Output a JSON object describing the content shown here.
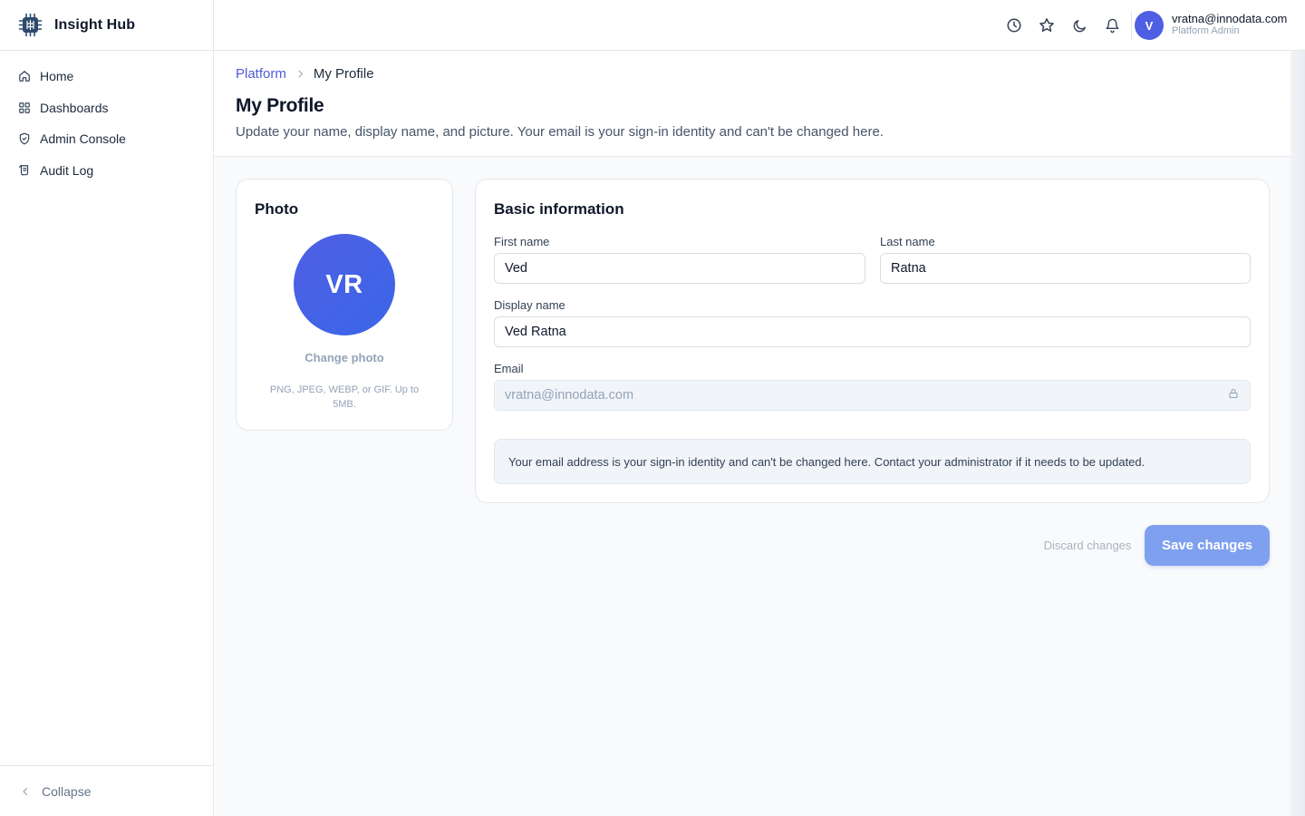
{
  "app": {
    "name": "Insight Hub"
  },
  "sidebar": {
    "items": [
      {
        "label": "Home",
        "icon": "home-icon"
      },
      {
        "label": "Dashboards",
        "icon": "grid-icon"
      },
      {
        "label": "Admin Console",
        "icon": "shield-check-icon"
      },
      {
        "label": "Audit Log",
        "icon": "scroll-icon"
      }
    ],
    "collapse_label": "Collapse"
  },
  "topbar": {
    "icons": [
      "history-icon",
      "star-icon",
      "moon-icon",
      "bell-icon"
    ],
    "user": {
      "initial": "V",
      "email": "vratna@innodata.com",
      "role": "Platform Admin"
    }
  },
  "breadcrumb": {
    "parent": "Platform",
    "current": "My Profile"
  },
  "page": {
    "title": "My Profile",
    "subtitle": "Update your name, display name, and picture. Your email is your sign-in identity and can't be changed here."
  },
  "photo_card": {
    "title": "Photo",
    "initials": "VR",
    "change_label": "Change photo",
    "hint": "PNG, JPEG, WEBP, or GIF. Up to 5MB."
  },
  "basic_info": {
    "title": "Basic information",
    "first_name": {
      "label": "First name",
      "value": "Ved"
    },
    "last_name": {
      "label": "Last name",
      "value": "Ratna"
    },
    "display_name": {
      "label": "Display name",
      "value": "Ved Ratna"
    },
    "email": {
      "label": "Email",
      "value": "vratna@innodata.com"
    },
    "notice": "Your email address is your sign-in identity and can't be changed here. Contact your administrator if it needs to be updated."
  },
  "actions": {
    "discard_label": "Discard changes",
    "save_label": "Save changes"
  },
  "colors": {
    "accent": "#4f5fe3",
    "save_button": "#7ea0ef",
    "link": "#4f5bd5"
  }
}
